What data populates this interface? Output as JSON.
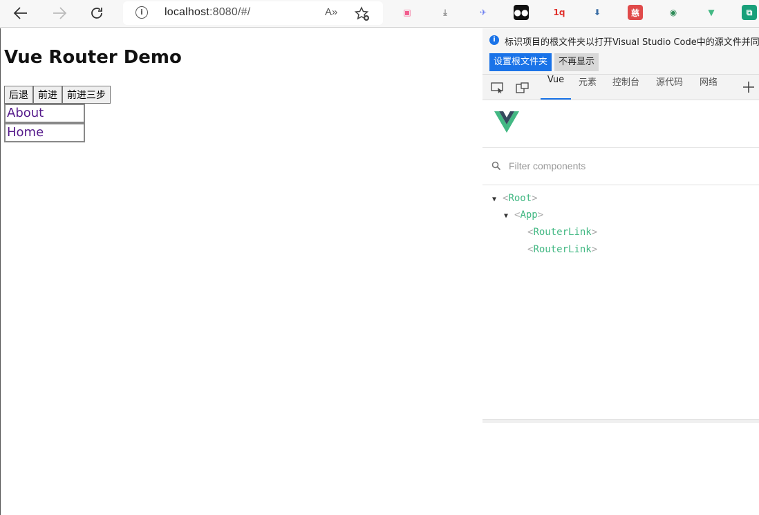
{
  "browser": {
    "url_host": "localhost",
    "url_rest": ":8080/#/",
    "read_aloud_label": "A»"
  },
  "extensions": [
    {
      "name": "bilibili-icon",
      "glyph": "▣",
      "color": "#f25d8e",
      "bg": "transparent"
    },
    {
      "name": "download-icon",
      "glyph": "⤓",
      "color": "#888888",
      "bg": "transparent"
    },
    {
      "name": "swift-bird-icon",
      "glyph": "✈",
      "color": "#6a7df0",
      "bg": "transparent"
    },
    {
      "name": "tampermonkey-icon",
      "glyph": "●●",
      "color": "#ffffff",
      "bg": "#111111"
    },
    {
      "name": "iq-icon",
      "glyph": "1q",
      "color": "#e0302b",
      "bg": "transparent"
    },
    {
      "name": "save-page-icon",
      "glyph": "⬇",
      "color": "#3b6ea5",
      "bg": "transparent"
    },
    {
      "name": "red-tag-icon",
      "glyph": "慈",
      "color": "#ffffff",
      "bg": "#e04a4a"
    },
    {
      "name": "globe-icon",
      "glyph": "◉",
      "color": "#2e8b57",
      "bg": "transparent"
    },
    {
      "name": "vue-devtools-icon",
      "glyph": "▼",
      "color": "#42b883",
      "bg": "transparent"
    },
    {
      "name": "copy-icon",
      "glyph": "⧉",
      "color": "#ffffff",
      "bg": "#18a07a"
    }
  ],
  "page": {
    "title": "Vue Router Demo",
    "buttons": [
      "后退",
      "前进",
      "前进三步"
    ],
    "links": [
      "About",
      "Home"
    ]
  },
  "devtools": {
    "notice": "标识项目的根文件夹以打开Visual Studio Code中的源文件并同",
    "set_root_button": "设置根文件夹",
    "dont_show_button": "不再显示",
    "tabs": [
      "Vue",
      "元素",
      "控制台",
      "源代码",
      "网络"
    ],
    "active_tab": "Vue",
    "filter_placeholder": "Filter components",
    "tree": [
      {
        "name": "Root",
        "open": "▼",
        "depth": 0
      },
      {
        "name": "App",
        "open": "▼",
        "depth": 1
      },
      {
        "name": "RouterLink",
        "open": "",
        "depth": 2
      },
      {
        "name": "RouterLink",
        "open": "",
        "depth": 2
      }
    ],
    "accent": "#1a73e8",
    "vue_green": "#42b883"
  }
}
